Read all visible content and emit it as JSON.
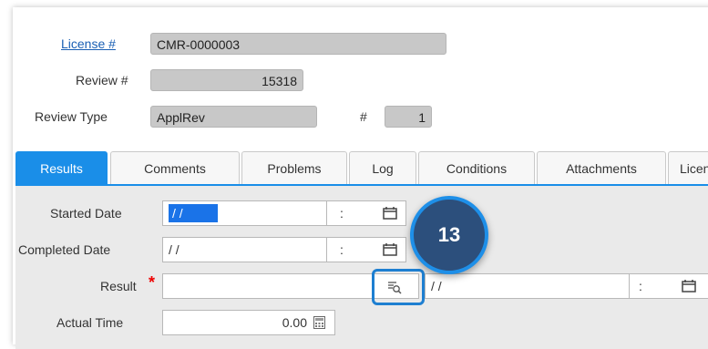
{
  "header": {
    "license_label": "License #",
    "license_value": "CMR-0000003",
    "review_label": "Review #",
    "review_value": "15318",
    "review_type_label": "Review Type",
    "review_type_value": "ApplRev",
    "hash_label": "#",
    "hash_value": "1"
  },
  "tabs": [
    {
      "label": "Results",
      "active": true
    },
    {
      "label": "Comments",
      "active": false
    },
    {
      "label": "Problems",
      "active": false
    },
    {
      "label": "Log",
      "active": false
    },
    {
      "label": "Conditions",
      "active": false
    },
    {
      "label": "Attachments",
      "active": false
    },
    {
      "label": "Licen",
      "active": false
    }
  ],
  "form": {
    "started_date_label": "Started Date",
    "started_date_value": "/ /",
    "completed_date_label": "Completed Date",
    "completed_date_value": "/ /",
    "result_label": "Result",
    "required_mark": "*",
    "result_value": "",
    "result_date_value": "/ /",
    "actual_time_label": "Actual Time",
    "actual_time_value": "0.00",
    "time_colon": ":"
  },
  "callout": {
    "number": "13"
  },
  "colors": {
    "accent": "#1a8ee8",
    "callout_fill": "#2c4f7c",
    "readonly": "#c8c8c8"
  }
}
